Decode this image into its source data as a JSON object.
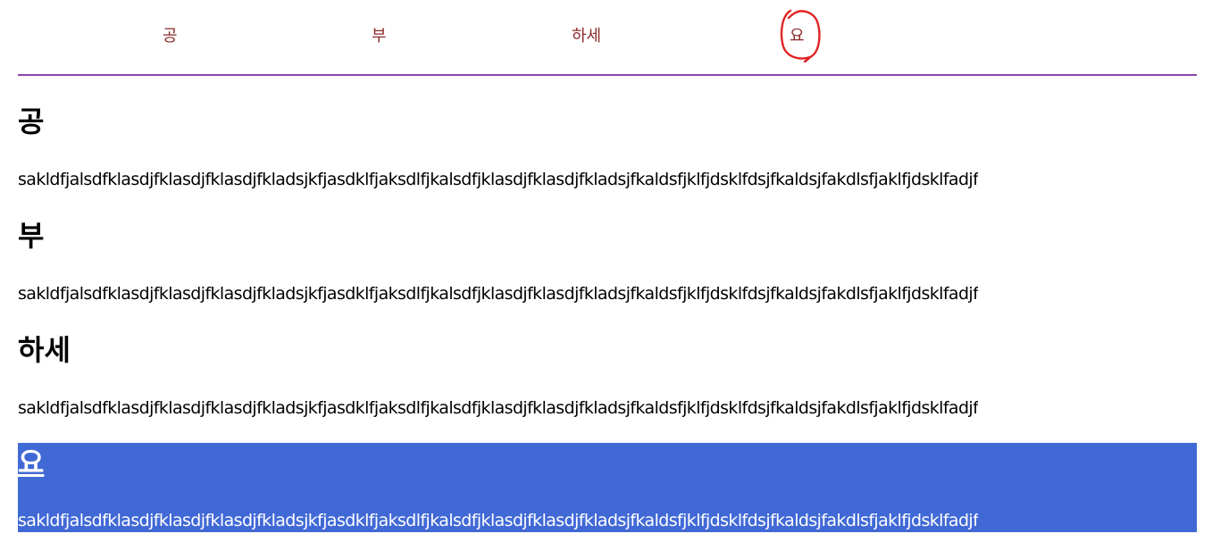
{
  "nav": {
    "items": [
      {
        "label": "공"
      },
      {
        "label": "부"
      },
      {
        "label": "하세"
      },
      {
        "label": "요"
      }
    ],
    "border_color": "#8e44ad",
    "link_color": "#8b2a2a"
  },
  "sections": [
    {
      "heading": "공",
      "text": "sakldfjalsdfklasdjfklasdjfklasdjfkladsjkfjasdklfjaksdlfjkalsdfjklasdjfklasdjfkladsjfkaldsfjklfjdsklfdsjfkaldsjfakdlsfjaklfjdsklfadjf"
    },
    {
      "heading": "부",
      "text": "sakldfjalsdfklasdjfklasdjfklasdjfkladsjkfjasdklfjaksdlfjkalsdfjklasdjfklasdjfkladsjfkaldsfjklfjdsklfdsjfkaldsjfakdlsfjaklfjdsklfadjf"
    },
    {
      "heading": "하세",
      "text": "sakldfjalsdfklasdjfklasdjfklasdjfkladsjkfjasdklfjaksdlfjkalsdfjklasdjfklasdjfkladsjfkaldsfjklfjdsklfdsjfkaldsjfakdlsfjaklfjdsklfadjf"
    },
    {
      "heading": "요",
      "text": "sakldfjalsdfklasdjfklasdjfklasdjfkladsjkfjasdklfjaksdlfjkalsdfjklasdjfklasdjfkladsjfkaldsfjklfjdsklfdsjfkaldsjfakdlsfjaklfjdsklfadjf"
    }
  ],
  "highlight_color": "#4169d6",
  "annotation_color": "#e02424"
}
